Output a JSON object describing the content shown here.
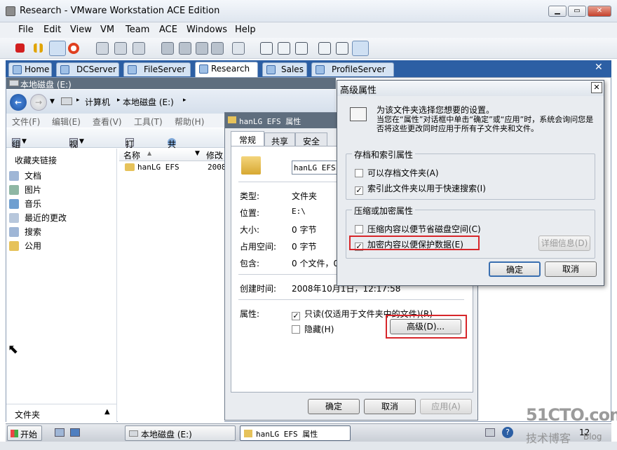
{
  "window": {
    "title": "Research - VMware Workstation ACE Edition"
  },
  "menu": [
    "File",
    "Edit",
    "View",
    "VM",
    "Team",
    "ACE",
    "Windows",
    "Help"
  ],
  "tabs": [
    "Home",
    "DCServer",
    "FileServer",
    "Research",
    "Sales",
    "ProfileServer"
  ],
  "explorer": {
    "title": "本地磁盘 (E:)",
    "breadcrumb": [
      "计算机",
      "本地磁盘 (E:)"
    ],
    "menu": [
      "文件(F)",
      "编辑(E)",
      "查看(V)",
      "工具(T)",
      "帮助(H)"
    ],
    "commands": {
      "organize": "组织",
      "views": "视图",
      "open": "打开",
      "share": "共享"
    },
    "favorites_header": "收藏夹链接",
    "favorites": [
      "文档",
      "图片",
      "音乐",
      "最近的更改",
      "搜索",
      "公用"
    ],
    "folders_label": "文件夹",
    "columns": {
      "name": "名称",
      "modified": "修改"
    },
    "files": [
      {
        "name": "hanLG EFS",
        "date": "2008"
      }
    ]
  },
  "properties": {
    "title": "hanLG EFS 属性",
    "tabs": [
      "常规",
      "共享",
      "安全"
    ],
    "folder_name": "hanLG EFS",
    "rows": [
      {
        "label": "类型:",
        "value": "文件夹"
      },
      {
        "label": "位置:",
        "value": "E:\\"
      },
      {
        "label": "大小:",
        "value": "0 字节"
      },
      {
        "label": "占用空间:",
        "value": "0 字节"
      },
      {
        "label": "包含:",
        "value": "0 个文件，0"
      }
    ],
    "created_label": "创建时间:",
    "created_value": "2008年10月1日，12:17:58",
    "attributes_label": "属性:",
    "readonly": "只读(仅适用于文件夹中的文件)(R)",
    "hidden": "隐藏(H)",
    "advanced_button": "高级(D)...",
    "ok": "确定",
    "cancel": "取消",
    "apply": "应用(A)"
  },
  "advanced": {
    "title": "高级属性",
    "description": "为该文件夹选择您想要的设置。",
    "note": "当您在“属性”对话框中单击“确定”或“应用”时，系统会询问您是否将这些更改同时应用于所有子文件夹和文件。",
    "archive_group": "存档和索引属性",
    "archive": "可以存档文件夹(A)",
    "archive_checked": false,
    "index": "索引此文件夹以用于快速搜索(I)",
    "index_checked": true,
    "compress_group": "压缩或加密属性",
    "compress": "压缩内容以便节省磁盘空间(C)",
    "compress_checked": false,
    "encrypt": "加密内容以便保护数据(E)",
    "encrypt_checked": true,
    "details": "详细信息(D)",
    "ok": "确定",
    "cancel": "取消"
  },
  "taskbar": {
    "start": "开始",
    "tasks": [
      "本地磁盘 (E:)",
      "hanLG EFS 属性"
    ],
    "clock": "12"
  },
  "watermark": {
    "site": "51CTO.com",
    "sub": "技术博客",
    "blog": "Blog"
  },
  "colors": {
    "highlight": "#d7262a",
    "tabbar": "#2c5fa4",
    "titlebar_dark": "#5f6e7e"
  }
}
